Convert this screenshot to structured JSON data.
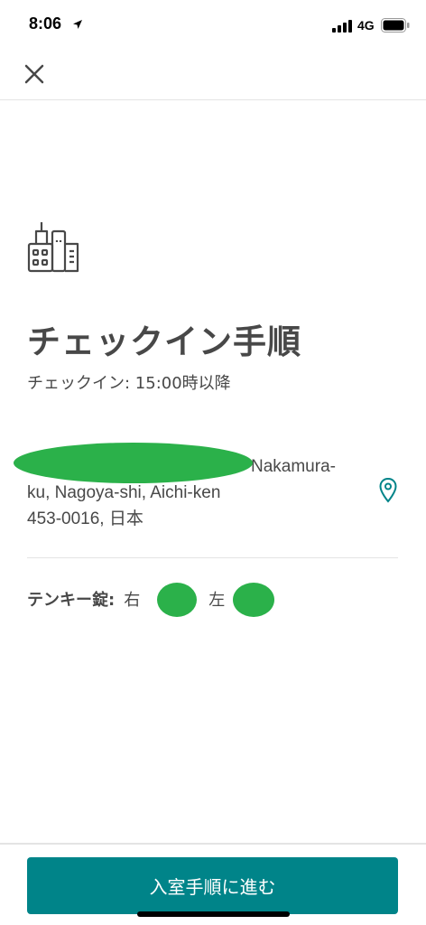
{
  "status_bar": {
    "time": "8:06",
    "network": "4G"
  },
  "nav": {
    "close_icon": "close-icon"
  },
  "header": {
    "icon": "building-icon",
    "title": "チェックイン手順",
    "checkin_time": "チェックイン: 15:00時以降"
  },
  "address": {
    "line1": "Nakamura-",
    "line2": "ku, Nagoya-shi, Aichi-ken",
    "line3": "453-0016, 日本",
    "pin_icon": "map-pin-icon"
  },
  "keypad": {
    "label": "テンキー錠:",
    "right_label": "右",
    "separator": "、",
    "left_label": "左"
  },
  "footer": {
    "button_label": "入室手順に進む"
  },
  "colors": {
    "accent": "#008489",
    "text": "#484848",
    "redaction": "#2bb14a"
  }
}
